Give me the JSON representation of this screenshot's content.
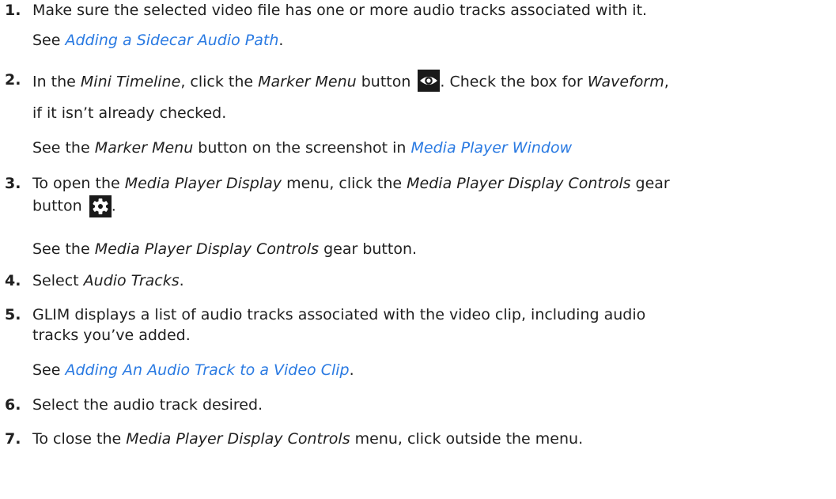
{
  "steps": [
    {
      "number": "1.",
      "line1": "Make sure the selected video file has one or more audio tracks associated with it.",
      "see_prefix": "See ",
      "see_link": "Adding a Sidecar Audio Path",
      "see_suffix": "."
    },
    {
      "number": "2.",
      "p1": "In the ",
      "i1": "Mini Timeline",
      "p2": ", click the ",
      "i2": "Marker Menu",
      "p3": " button ",
      "icon": "eye-icon",
      "p4": ". Check the box for ",
      "i3": "Waveform",
      "p5": ",",
      "line2": "if it isn’t already checked.",
      "see_p1": "See the ",
      "see_i1": "Marker Menu",
      "see_p2": " button on the screenshot in ",
      "see_link": "Media Player Window"
    },
    {
      "number": "3.",
      "p1": "To open the ",
      "i1": "Media Player Display",
      "p2": " menu, click the ",
      "i2": "Media Player Display Controls",
      "p3": " gear",
      "line2": "button ",
      "icon": "gear-icon",
      "line2_end": ".",
      "see_p1": "See the ",
      "see_i1": "Media Player Display Controls",
      "see_p2": " gear button."
    },
    {
      "number": "4.",
      "p1": "Select ",
      "i1": "Audio Tracks",
      "p2": "."
    },
    {
      "number": "5.",
      "line1": "GLIM displays a list of audio tracks associated with the video clip, including audio",
      "line2": "tracks you’ve added.",
      "see_prefix": "See ",
      "see_link": "Adding An Audio Track to a Video Clip",
      "see_suffix": "."
    },
    {
      "number": "6.",
      "line1": "Select the audio track desired."
    },
    {
      "number": "7.",
      "p1": "To close the ",
      "i1": "Media Player Display Controls",
      "p2": " menu, click outside the menu."
    }
  ]
}
